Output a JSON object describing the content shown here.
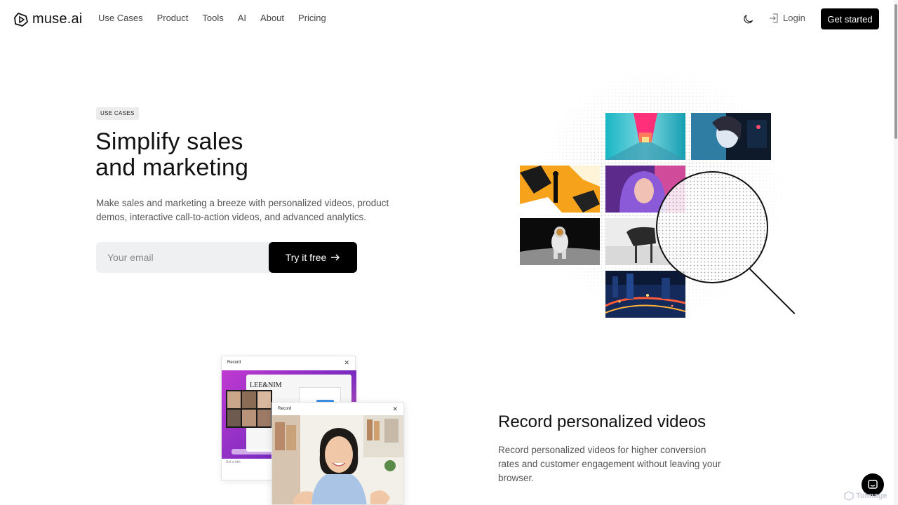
{
  "brand": {
    "name": "muse.ai"
  },
  "nav": {
    "links": [
      "Use Cases",
      "Product",
      "Tools",
      "AI",
      "About",
      "Pricing"
    ],
    "login_label": "Login",
    "cta_label": "Get started"
  },
  "hero": {
    "badge": "USE CASES",
    "title_line1": "Simplify sales",
    "title_line2": "and marketing",
    "description": "Make sales and marketing a breeze with personalized videos, product demos, interactive call-to-action videos, and advanced analytics.",
    "email_placeholder": "Your email",
    "cta_label": "Try it free"
  },
  "section2": {
    "title": "Record personalized videos",
    "description": "Record personalized videos for higher conversion rates and customer engagement without leaving your browser.",
    "window1_title": "Record",
    "window2_title": "Record",
    "brand_in_screen": "LEE&NIM",
    "title_field_placeholder": "Set a title"
  },
  "watermark": "ToImage",
  "colors": {
    "primary": "#000000",
    "text": "#111111",
    "muted": "#555555",
    "input_bg": "#eff0f2"
  }
}
